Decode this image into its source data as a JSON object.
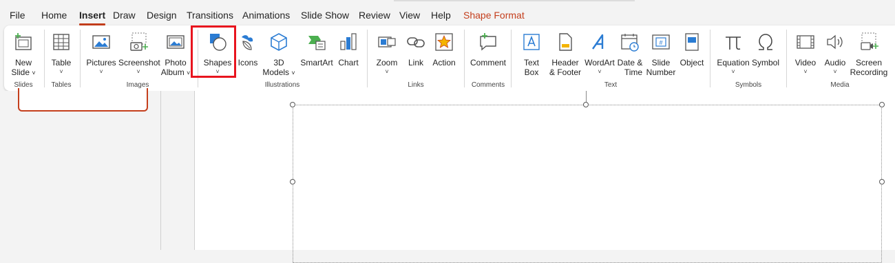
{
  "menu": {
    "tabs": [
      "File",
      "Home",
      "Insert",
      "Draw",
      "Design",
      "Transitions",
      "Animations",
      "Slide Show",
      "Review",
      "View",
      "Help",
      "Shape Format"
    ]
  },
  "ribbon": {
    "slides": {
      "new_slide_l1": "New",
      "new_slide_l2": "Slide",
      "group": "Slides"
    },
    "tables": {
      "table": "Table",
      "group": "Tables"
    },
    "images": {
      "pictures": "Pictures",
      "screenshot": "Screenshot",
      "photo_album_l1": "Photo",
      "photo_album_l2": "Album",
      "group": "Images"
    },
    "illustrations": {
      "shapes": "Shapes",
      "icons": "Icons",
      "models_l1": "3D",
      "models_l2": "Models",
      "smartart": "SmartArt",
      "chart": "Chart",
      "group": "Illustrations"
    },
    "links": {
      "zoom": "Zoom",
      "link": "Link",
      "action": "Action",
      "group": "Links"
    },
    "comments": {
      "comment": "Comment",
      "group": "Comments"
    },
    "text": {
      "textbox_l1": "Text",
      "textbox_l2": "Box",
      "header_l1": "Header",
      "header_l2": "& Footer",
      "wordart": "WordArt",
      "date_l1": "Date &",
      "date_l2": "Time",
      "slidenum_l1": "Slide",
      "slidenum_l2": "Number",
      "object": "Object",
      "group": "Text"
    },
    "symbols": {
      "equation": "Equation",
      "symbol": "Symbol",
      "group": "Symbols"
    },
    "media": {
      "video": "Video",
      "audio": "Audio",
      "screen_l1": "Screen",
      "screen_l2": "Recording",
      "group": "Media"
    },
    "chevron": "˅"
  },
  "colors": {
    "accent": "#c43e1c",
    "highlight": "#e8141e",
    "icon_blue": "#2b7cd3",
    "icon_green": "#4caf50"
  }
}
